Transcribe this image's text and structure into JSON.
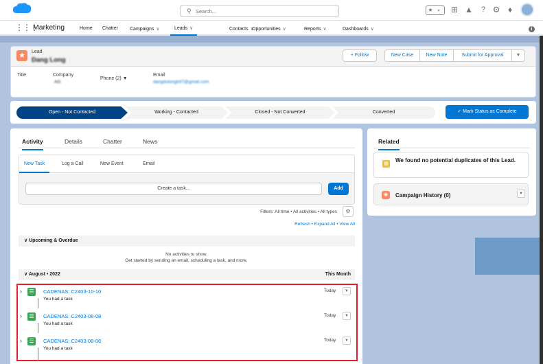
{
  "header": {
    "search_placeholder": "Search...",
    "icons": [
      "favorites-star-icon",
      "favorites-list-icon",
      "global-actions-icon",
      "trailhead-icon",
      "help-icon",
      "setup-gear-icon",
      "notifications-bell-icon",
      "user-avatar"
    ]
  },
  "nav": {
    "app_name": "Marketing",
    "items": [
      {
        "label": "Home",
        "has_menu": false
      },
      {
        "label": "Chatter",
        "has_menu": false
      },
      {
        "label": "Campaigns",
        "has_menu": true
      },
      {
        "label": "Leads",
        "has_menu": true,
        "active": true
      },
      {
        "label": "Contacts",
        "has_menu": true
      },
      {
        "label": "Opportunities",
        "has_menu": true
      },
      {
        "label": "Reports",
        "has_menu": true
      },
      {
        "label": "Dashboards",
        "has_menu": true
      }
    ]
  },
  "record": {
    "object_label": "Lead",
    "name": "Dang Long",
    "buttons": {
      "follow": "+ Follow",
      "new_case": "New Case",
      "new_note": "New Note",
      "submit": "Submit for Approval"
    },
    "fields": {
      "title_label": "Title",
      "company_label": "Company",
      "company_value": "AG",
      "phone_label": "Phone (2)",
      "email_label": "Email",
      "email_value": "dangdulongtr87@gmail.com"
    }
  },
  "path": {
    "stages": [
      "Open - Not Contacted",
      "Working - Contacted",
      "Closed - Not Converted",
      "Converted"
    ],
    "current": 0,
    "complete_button": "Mark Status as Complete"
  },
  "activity": {
    "tabs": [
      "Activity",
      "Details",
      "Chatter",
      "News"
    ],
    "composer_tabs": [
      "New Task",
      "Log a Call",
      "New Event",
      "Email"
    ],
    "task_placeholder": "Create a task...",
    "add_label": "Add",
    "filters": "Filters: All time • All activities • All types",
    "links": "Refresh • Expand All • View All",
    "upcoming_label": "Upcoming & Overdue",
    "no_activities": "No activities to show.",
    "no_activities_hint": "Get started by sending an email, scheduling a task, and more.",
    "month_label": "August • 2022",
    "this_month": "This Month",
    "tasks": [
      {
        "title": "CADENAS: C2403-10-10",
        "subtitle": "You had a task",
        "date": "Today"
      },
      {
        "title": "CADENAS: C2403-08-08",
        "subtitle": "You had a task",
        "date": "Today"
      },
      {
        "title": "CADENAS: C2403-08-08",
        "subtitle": "You had a task",
        "date": "Today"
      }
    ]
  },
  "related": {
    "title": "Related",
    "duplicates_text": "We found no potential duplicates of this Lead.",
    "campaign_history": "Campaign History (0)"
  },
  "colors": {
    "brand_blue": "#0176d3",
    "path_current": "#014486",
    "lead_orange": "#f88962",
    "task_green": "#3ba755",
    "highlight_red": "#e0202e"
  }
}
